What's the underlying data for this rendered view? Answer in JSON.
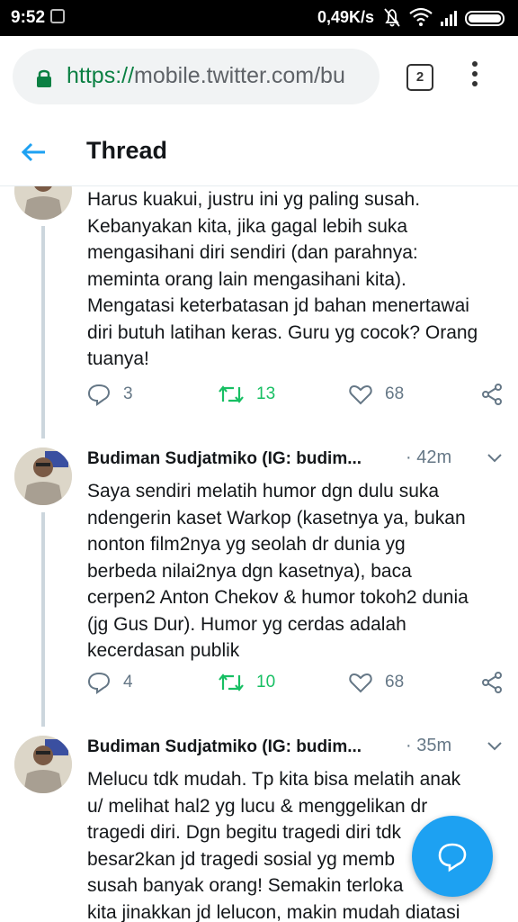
{
  "status_bar": {
    "time": "9:52",
    "net_speed": "0,49K/s",
    "icons": [
      "app-notification-icon",
      "mute-icon",
      "wifi-icon",
      "signal-icon",
      "battery-icon"
    ]
  },
  "browser": {
    "url_scheme": "https://",
    "url_host": "mobile.twitter.com/bu",
    "tab_count": "2",
    "lock_color": "#0b8043"
  },
  "app_bar": {
    "title": "Thread"
  },
  "accent_color": "#1da1f2",
  "retweet_color": "#17bf63",
  "tweets": [
    {
      "name": "",
      "time": "",
      "lines": [
        "Harus kuakui, justru ini yg paling susah.",
        "Kebanyakan kita, jika gagal lebih suka",
        "mengasihani diri sendiri (dan parahnya:",
        "meminta orang lain mengasihani kita).",
        "Mengatasi keterbatasan jd bahan menertawai",
        "diri butuh latihan keras. Guru yg cocok? Orang",
        "tuanya!"
      ],
      "replies": "3",
      "retweets": "13",
      "likes": "68"
    },
    {
      "name": "Budiman Sudjatmiko (IG: budim...",
      "time": "· 42m",
      "lines": [
        "Saya sendiri melatih humor dgn dulu suka",
        "ndengerin kaset Warkop (kasetnya ya, bukan",
        "nonton film2nya yg seolah dr dunia yg",
        "berbeda nilai2nya dgn kasetnya), baca",
        "cerpen2 Anton Chekov & humor tokoh2 dunia",
        "(jg Gus Dur). Humor yg cerdas adalah",
        "kecerdasan publik"
      ],
      "replies": "4",
      "retweets": "10",
      "likes": "68"
    },
    {
      "name": "Budiman Sudjatmiko (IG: budim...",
      "time": "· 35m",
      "lines": [
        "Melucu tdk mudah. Tp kita bisa melatih anak",
        "u/ melihat hal2 yg lucu & menggelikan dr",
        "tragedi diri. Dgn begitu tragedi diri tdk",
        "besar2kan jd tragedi sosial yg memb",
        "susah banyak orang! Semakin terloka",
        "kita jinakkan jd lelucon, makin mudah diatasi"
      ]
    }
  ]
}
